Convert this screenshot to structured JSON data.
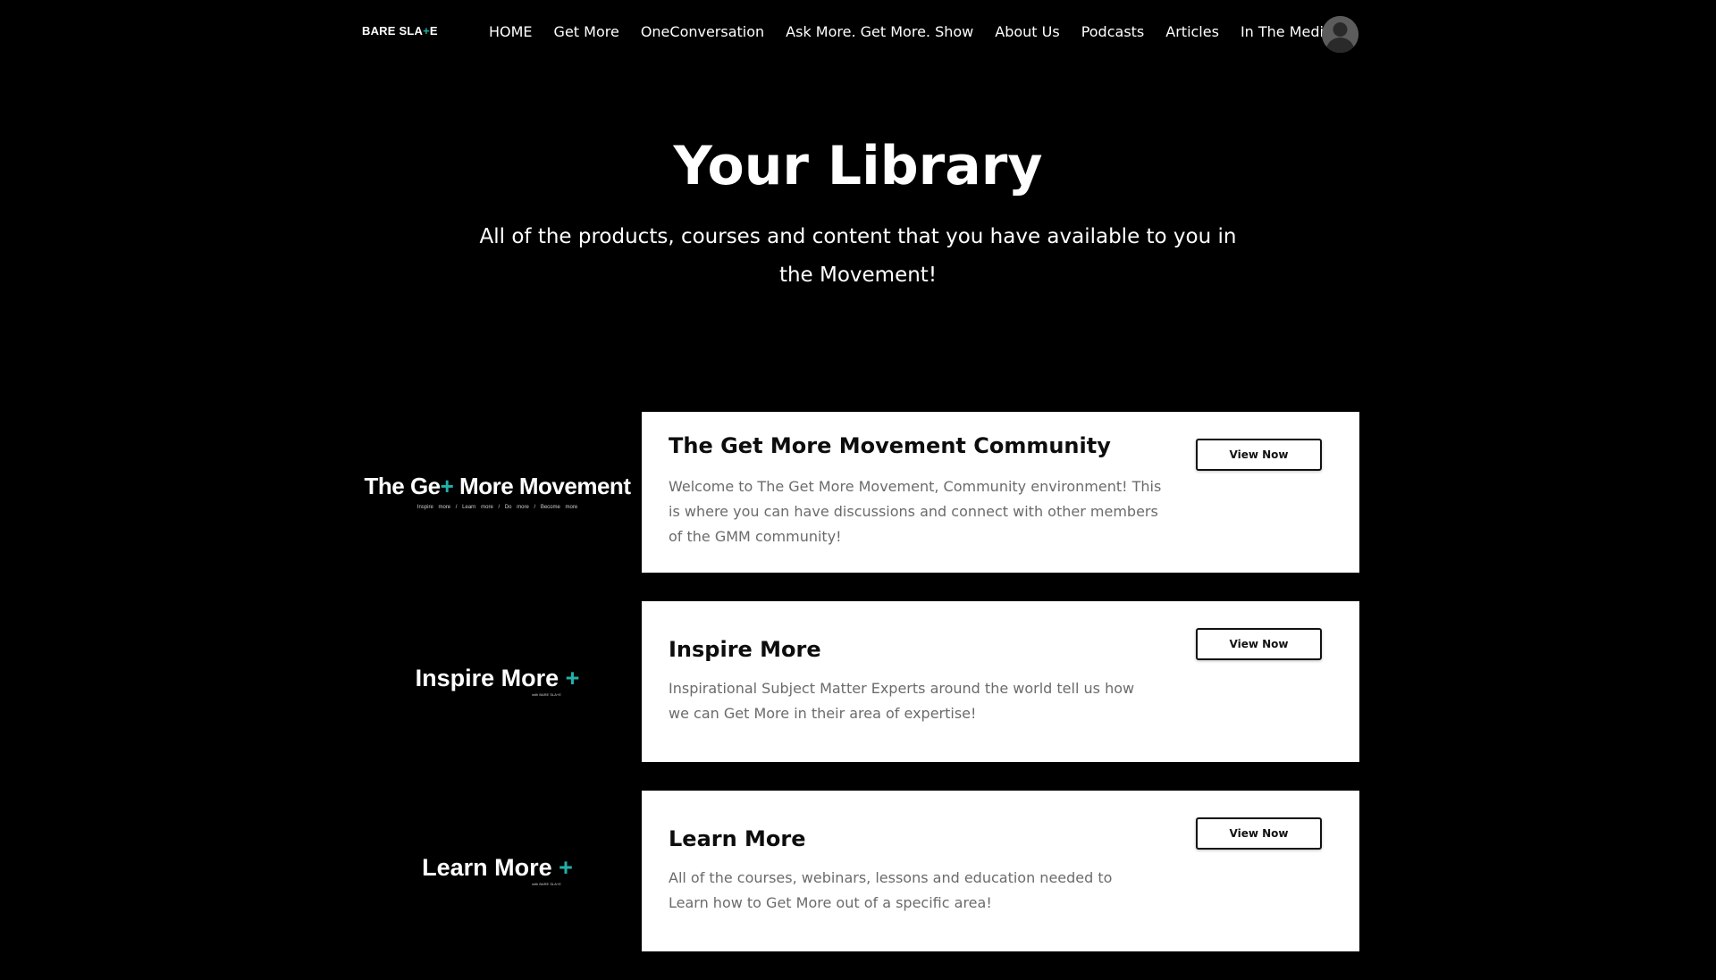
{
  "header": {
    "logo": {
      "text_before": "BARE SLA",
      "plus": "+",
      "text_after": "E"
    },
    "nav": [
      "HOME",
      "Get More",
      "OneConversation",
      "Ask More. Get More. Show",
      "About Us",
      "Podcasts",
      "Articles",
      "In The Media"
    ],
    "avatar_icon": "user-avatar-icon"
  },
  "hero": {
    "title": "Your Library",
    "subtitle": "All of the products, courses and content that you have available to you in the Movement!"
  },
  "library": [
    {
      "thumb": {
        "before": "The Ge",
        "plus": "+",
        "after": " More Movement",
        "tagline": "Inspire more  /  Learn more  /  Do more  /  Become more"
      },
      "title": "The Get More Movement Community",
      "description": "Welcome to The Get More Movement, Community environment! This is where you can have discussions and connect with other members of the GMM community!",
      "button": "View Now"
    },
    {
      "thumb": {
        "before": "Inspire More ",
        "plus": "+",
        "after": "",
        "tag": "with BARE SLA+E"
      },
      "title": "Inspire More",
      "description": "Inspirational Subject Matter Experts around the world tell us how we can Get More in their area of expertise!",
      "button": "View Now"
    },
    {
      "thumb": {
        "before": "Learn More ",
        "plus": "+",
        "after": "",
        "tag": "with BARE SLA+E"
      },
      "title": "Learn More",
      "description": "All of the courses, webinars, lessons and education needed to Learn how to Get More out of a specific area!",
      "button": "View Now"
    }
  ],
  "colors": {
    "background": "#000000",
    "accent": "#22b0a8",
    "card": "#ffffff",
    "description_text": "#6b6b6b"
  }
}
